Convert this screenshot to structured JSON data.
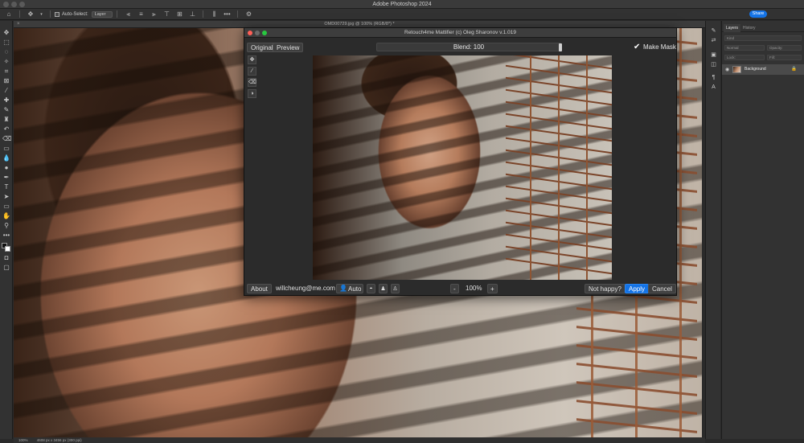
{
  "app": {
    "title": "Adobe Photoshop 2024"
  },
  "options_bar": {
    "auto_select_label": "Auto-Select:",
    "auto_select_value": "Layer",
    "share_label": "Share"
  },
  "document": {
    "tab_title": "OMD00729.jpg @ 100% (RGB/8*) *",
    "zoom": "100%",
    "dimensions": "4608 px x 3456 px (300 ppi)"
  },
  "panel": {
    "tabs": [
      "Layers",
      "History"
    ],
    "search_placeholder": "Kind",
    "blend_mode": "Normal",
    "opacity_label": "Opacity:",
    "lock_label": "Lock:",
    "fill_label": "Fill:",
    "layer_name": "Background"
  },
  "dialog": {
    "title": "Retouch4me Mattifier (c) Oleg Sharonov v.1.019",
    "original_label": "Original",
    "preview_label": "Preview",
    "blend_label": "Blend: 100",
    "blend_value": 100,
    "make_mask_label": "Make Mask",
    "about_label": "About",
    "email": "willcheung@me.com",
    "auto_label": "Auto",
    "zoom_minus": "-",
    "zoom_value": "100%",
    "zoom_plus": "+",
    "not_happy_label": "Not happy?",
    "apply_label": "Apply",
    "cancel_label": "Cancel"
  },
  "icons": {
    "move": "move-icon",
    "home": "home-icon",
    "brush": "brush-icon",
    "eraser": "eraser-icon",
    "mask": "mask-icon",
    "eye": "eye-icon",
    "lock": "lock-icon"
  },
  "colors": {
    "accent": "#1473e6",
    "ui_dark": "#323232",
    "dialog_bg": "#2b2b2b"
  }
}
